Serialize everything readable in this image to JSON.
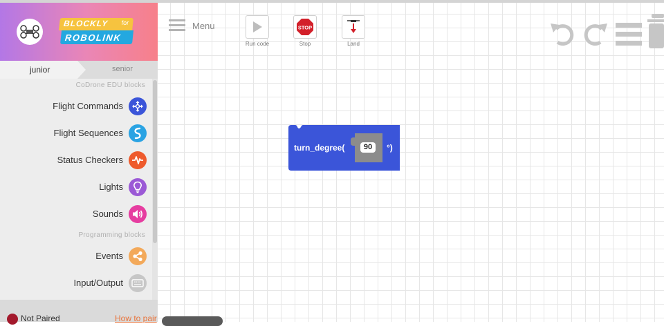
{
  "brand": {
    "line1": "BLOCKLY",
    "line1_suffix": "for",
    "line2": "ROBOLINK"
  },
  "tabs": [
    {
      "label": "junior"
    },
    {
      "label": "senior"
    }
  ],
  "sections": {
    "codrone": "CoDrone EDU blocks",
    "programming": "Programming blocks"
  },
  "categories": [
    {
      "label": "Flight Commands",
      "color": "#3b55d9",
      "icon": "drone-arrows-icon"
    },
    {
      "label": "Flight Sequences",
      "color": "#2aa3e3",
      "icon": "s-curve-icon"
    },
    {
      "label": "Status Checkers",
      "color": "#ee5a2c",
      "icon": "pulse-icon"
    },
    {
      "label": "Lights",
      "color": "#9b59d6",
      "icon": "lightbulb-icon"
    },
    {
      "label": "Sounds",
      "color": "#e63da0",
      "icon": "speaker-icon"
    },
    {
      "label": "Events",
      "color": "#f3a95a",
      "icon": "share-icon"
    },
    {
      "label": "Input/Output",
      "color": "#c7c7c7",
      "icon": "keyboard-icon"
    }
  ],
  "footer": {
    "status": "Not Paired",
    "pair_link": "How to pair"
  },
  "toolbar": {
    "menu_label": "Menu",
    "run_label": "Run code",
    "stop_label": "Stop",
    "stop_sign": "STOP",
    "land_label": "Land"
  },
  "block": {
    "name": "turn_degree(",
    "value": "90",
    "suffix": "°)",
    "color": "#3b55d9"
  }
}
